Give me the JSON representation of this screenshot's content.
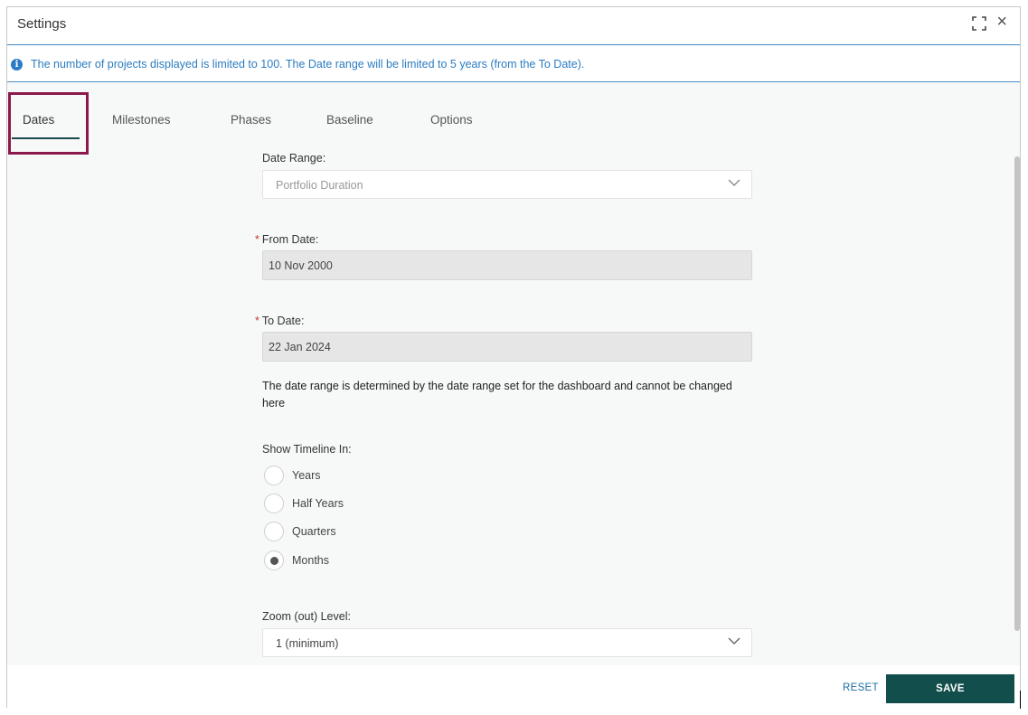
{
  "dialog": {
    "title": "Settings",
    "info_text": "The number of projects displayed is limited to 100. The Date range will be limited to 5 years (from the To Date)."
  },
  "tabs": [
    {
      "label": "Dates",
      "active": true
    },
    {
      "label": "Milestones",
      "active": false
    },
    {
      "label": "Phases",
      "active": false
    },
    {
      "label": "Baseline",
      "active": false
    },
    {
      "label": "Options",
      "active": false
    }
  ],
  "form": {
    "date_range_label": "Date Range:",
    "date_range_value": "Portfolio Duration",
    "from_date_label": "From Date:",
    "from_date_value": "10 Nov 2000",
    "to_date_label": "To Date:",
    "to_date_value": "22 Jan 2024",
    "required_marker": "*",
    "note": "The date range is determined by the date range set for the dashboard and cannot be changed here",
    "timeline_label": "Show Timeline In:",
    "timeline_options": [
      {
        "label": "Years",
        "checked": false
      },
      {
        "label": "Half Years",
        "checked": false
      },
      {
        "label": "Quarters",
        "checked": false
      },
      {
        "label": "Months",
        "checked": true
      }
    ],
    "zoom_label": "Zoom (out) Level:",
    "zoom_value": "1 (minimum)"
  },
  "footer": {
    "reset_label": "RESET",
    "save_label": "SAVE"
  },
  "icons": {
    "info": "info-icon",
    "expand": "expand-icon",
    "close": "close-icon",
    "chevron": "chevron-down-icon"
  },
  "colors": {
    "accent_blue": "#2a7cc0",
    "save_button": "#114e4c",
    "tab_highlight": "#8b1a4a"
  }
}
